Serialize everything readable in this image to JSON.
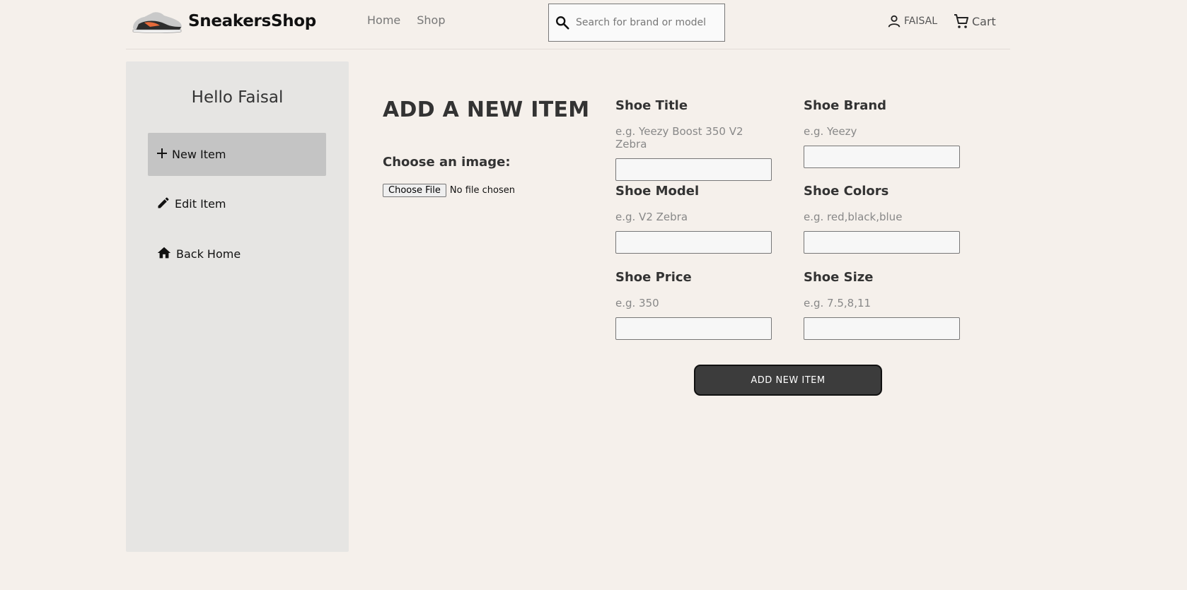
{
  "brand": {
    "name": "SneakersShop"
  },
  "nav": {
    "home": "Home",
    "shop": "Shop"
  },
  "search": {
    "placeholder": "Search for brand or model"
  },
  "user": {
    "name": "FAISAL",
    "cart": "Cart"
  },
  "sidebar": {
    "greeting": "Hello Faisal",
    "items": [
      {
        "label": "New Item",
        "icon": "plus-icon",
        "active": true
      },
      {
        "label": "Edit Item",
        "icon": "pencil-icon",
        "active": false
      },
      {
        "label": "Back Home",
        "icon": "home-icon",
        "active": false
      }
    ]
  },
  "main": {
    "title": "ADD A NEW ITEM",
    "image_label": "Choose an image:",
    "file_button": "Choose File",
    "file_status": "No file chosen",
    "fields": [
      {
        "label": "Shoe Title",
        "hint": "e.g. Yeezy Boost 350 V2 Zebra"
      },
      {
        "label": "Shoe Brand",
        "hint": "e.g. Yeezy"
      },
      {
        "label": "Shoe Model",
        "hint": "e.g. V2 Zebra"
      },
      {
        "label": "Shoe Colors",
        "hint": "e.g. red,black,blue"
      },
      {
        "label": "Shoe Price",
        "hint": "e.g. 350"
      },
      {
        "label": "Shoe Size",
        "hint": "e.g. 7.5,8,11"
      }
    ],
    "submit": "ADD NEW ITEM"
  },
  "colors": {
    "background": "#f5f0eb",
    "sidebar": "#e6e5e3",
    "active_item": "#c4c4c4",
    "button": "#3c3c3c"
  }
}
